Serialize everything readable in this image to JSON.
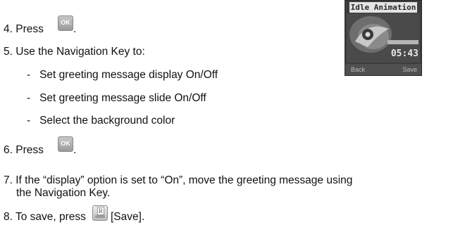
{
  "steps": [
    {
      "num": "4.",
      "text": "Press",
      "key": "OK",
      "after": "."
    },
    {
      "num": "5.",
      "text": "Use the Navigation Key to:"
    },
    {
      "num": "6.",
      "text": "Press",
      "key": "OK",
      "after": "."
    },
    {
      "num": "7.",
      "line1": "If the “display” option is set to “On”, move the greeting message using",
      "line2": "the Navigation Key."
    },
    {
      "num": "8.",
      "text": "To save, press",
      "key": "R",
      "after": "[Save]."
    }
  ],
  "bullets": [
    "Set greeting message display On/Off",
    "Set greeting message slide On/Off",
    "Select the background color"
  ],
  "bullet_mark": "-",
  "phone": {
    "title": "Idle Animation",
    "time": "05:43",
    "softkey_left": "Back",
    "softkey_right": "Save"
  }
}
